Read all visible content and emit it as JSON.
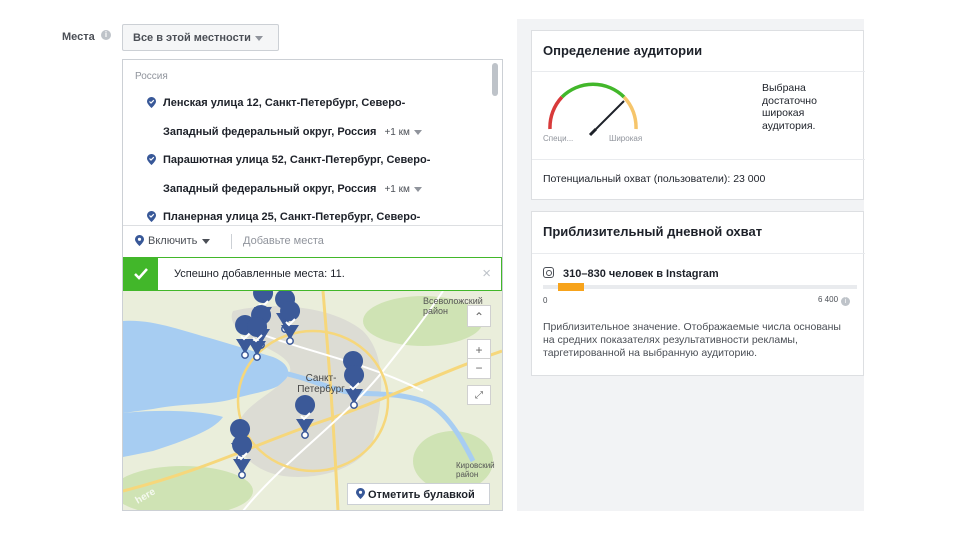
{
  "places": {
    "label": "Места",
    "info_icon": "info-icon",
    "dropdown_value": "Все в этой местности"
  },
  "locations": {
    "country": "Россия",
    "lines": [
      {
        "text": "Ленская улица 12, Санкт-Петербург, Северо-",
        "pin": true
      },
      {
        "text": "Западный федеральный округ, Россия",
        "radius": "+1 км"
      },
      {
        "text": "Парашютная улица 52, Санкт-Петербург, Северо-",
        "pin": true
      },
      {
        "text": "Западный федеральный округ, Россия",
        "radius": "+1 км"
      },
      {
        "text": "Планерная улица 25, Санкт-Петербург, Северо-",
        "pin": true
      }
    ]
  },
  "include": {
    "label": "Включить",
    "add_placeholder": "Добавьте места"
  },
  "success": {
    "message": "Успешно добавленные места: 11.",
    "close": "×"
  },
  "map": {
    "labels": {
      "vsevolozhsk": "Всеволожский район",
      "spb": "Санкт-Петербург",
      "kirovsky": "Кировский район",
      "here": "here"
    },
    "zoom_in": "+",
    "zoom_out": "−",
    "drop_pin_label": "Отметить булавкой"
  },
  "audience": {
    "title": "Определение аудитории",
    "gauge_low": "Специ...",
    "gauge_high": "Широкая",
    "description": "Выбрана достаточно широкая аудитория.",
    "potential_reach": "Потенциальный охват (пользователи): 23 000"
  },
  "daily_reach": {
    "title": "Приблизительный дневной охват",
    "instagram_line": "310–830 человек в Instagram",
    "bar_min": "0",
    "bar_max": "6 400",
    "range_min": 310,
    "range_max": 830,
    "scale_max": 6400,
    "estimate_note": "Приблизительное значение. Отображаемые числа основаны на средних показателях результативности рекламы, таргетированной на выбранную аудиторию."
  },
  "colors": {
    "success_green": "#42b72a",
    "pin_blue": "#385898",
    "bar_orange": "#f7a31b"
  }
}
